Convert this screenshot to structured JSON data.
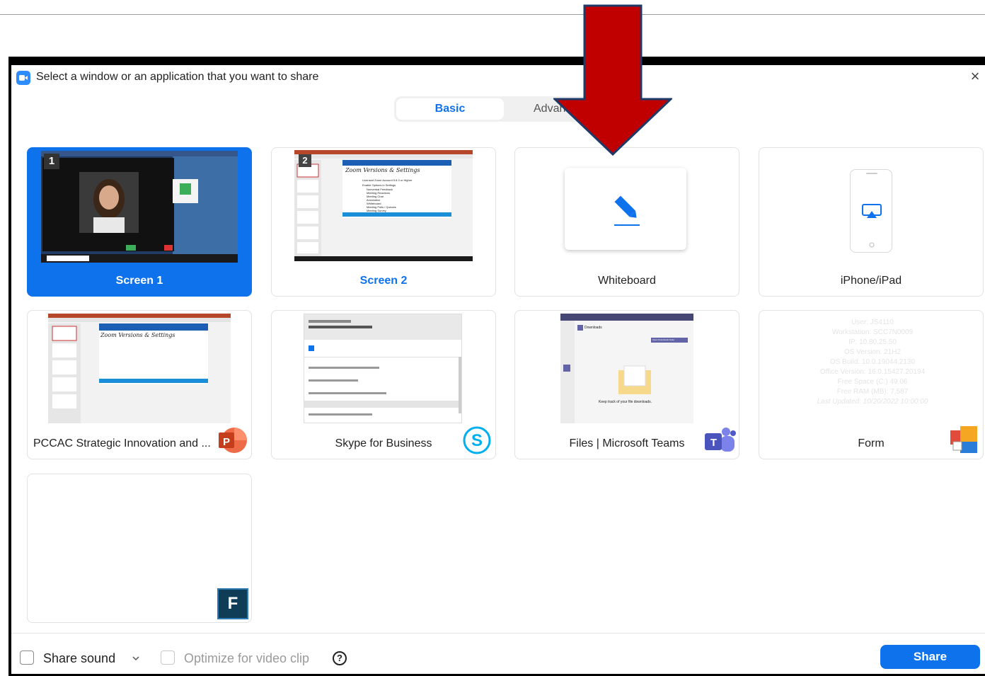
{
  "dialog": {
    "title": "Select a window or an application that you want to share",
    "close_glyph": "×"
  },
  "tabs": {
    "basic": "Basic",
    "advanced": "Advanced"
  },
  "cards": [
    {
      "label": "Screen 1",
      "badge": "1",
      "selected": true
    },
    {
      "label": "Screen 2",
      "badge": "2",
      "selected": false
    },
    {
      "label": "Whiteboard",
      "selected": false,
      "icon": "pen-icon"
    },
    {
      "label": "iPhone/iPad",
      "selected": false,
      "icon": "airplay-icon"
    },
    {
      "label": "PCCAC Strategic Innovation and ...",
      "selected": false,
      "icon": "powerpoint-icon",
      "icon_letter": "P"
    },
    {
      "label": "Skype for Business",
      "selected": false,
      "icon": "skype-icon"
    },
    {
      "label": "Files | Microsoft Teams",
      "selected": false,
      "icon": "teams-icon",
      "icon_letter": "T"
    },
    {
      "label": "Form",
      "selected": false,
      "icon": "form-app-icon"
    },
    {
      "label": "",
      "selected": false,
      "icon": "f-app-icon",
      "icon_letter": "F"
    }
  ],
  "thumbs": {
    "slide_title": "Zoom Versions & Settings",
    "slide_bullets": [
      "Licensed Zoom Account 5.8.3 or Higher",
      "Enable Options in Settings",
      "Nonverbal Feedback",
      "Meeting Reactions",
      "Meeting Chat",
      "Annotation",
      "Whiteboard",
      "Meeting Polls / Quizzes",
      "Meeting Survey"
    ],
    "teams_heading": "Downloads",
    "teams_button": "Open Downloads folder",
    "teams_caption": "Keep track of your file downloads.",
    "form_lines": [
      "User: JS4110",
      "Workstation: SCC7N0009",
      "IP: 10.80.25.50",
      "OS Version: 21H2",
      "OS Build: 10.0.19044.2130",
      "Office Version: 16.0.15427.20194",
      "Free Space (C:) 49.06",
      "Free RAM (MB): 7,587",
      "Last Updated: 10/20/2022 10:00:00"
    ]
  },
  "footer": {
    "share_sound": "Share sound",
    "optimize": "Optimize for video clip",
    "help_glyph": "?",
    "share_button": "Share"
  },
  "colors": {
    "accent": "#0e72ed",
    "arrow": "#c00000"
  }
}
